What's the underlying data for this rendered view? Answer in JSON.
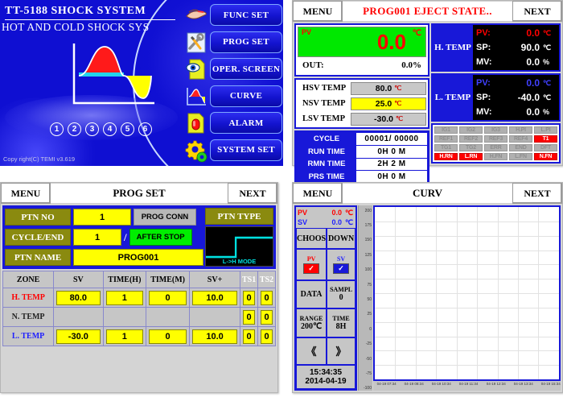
{
  "home": {
    "title_line1": "TT-5188   SHOCK SYSTEM",
    "title_line2": "HOT AND COLD SHOCK SYS",
    "copyright": "Copy right(C) TEMI v3.619",
    "step_numbers": [
      "1",
      "2",
      "3",
      "4",
      "5",
      "6"
    ],
    "menu": [
      {
        "label": "FUNC SET",
        "icon": "hand-pointer-icon"
      },
      {
        "label": "PROG SET",
        "icon": "wrench-screwdriver-icon"
      },
      {
        "label": "OPER. SCREEN",
        "icon": "eye-document-icon"
      },
      {
        "label": "CURVE",
        "icon": "curve-chart-icon"
      },
      {
        "label": "ALARM",
        "icon": "alarm-lamp-icon"
      },
      {
        "label": "SYSTEM SET",
        "icon": "gears-icon"
      }
    ]
  },
  "oper": {
    "menu_label": "MENU",
    "next_label": "NEXT",
    "title": "PROG001 EJECT STATE..",
    "pv_label": "PV",
    "pv_value": "0.0",
    "pv_unit": "℃",
    "out_label": "OUT:",
    "out_value": "0.0%",
    "sv_rows": [
      {
        "name": "HSV  TEMP",
        "value": "80.0",
        "unit": "℃",
        "style": "gray"
      },
      {
        "name": "NSV  TEMP",
        "value": "25.0",
        "unit": "℃",
        "style": "yellow"
      },
      {
        "name": "LSV  TEMP",
        "value": "-30.0",
        "unit": "℃",
        "style": "gray"
      }
    ],
    "cycle_rows": [
      {
        "name": "CYCLE",
        "value": "00001/ 00000"
      },
      {
        "name": "RUN TIME",
        "value": "0H  0 M"
      },
      {
        "name": "RMN TIME",
        "value": "2H  2 M"
      },
      {
        "name": "PRS TIME",
        "value": "0H  0 M"
      }
    ],
    "temp_blocks": [
      {
        "tag": "H. TEMP",
        "rows": [
          {
            "key": "PV:",
            "value": "0.0",
            "unit": "℃",
            "color": "#ff0000"
          },
          {
            "key": "SP:",
            "value": "90.0",
            "unit": "℃",
            "color": "#ffffff"
          },
          {
            "key": "MV:",
            "value": "0.0",
            "unit": "%",
            "color": "#ffffff"
          }
        ]
      },
      {
        "tag": "L. TEMP",
        "rows": [
          {
            "key": "PV:",
            "value": "0.0",
            "unit": "℃",
            "color": "#4040ff"
          },
          {
            "key": "SP:",
            "value": "-40.0",
            "unit": "℃",
            "color": "#ffffff"
          },
          {
            "key": "MV:",
            "value": "0.0",
            "unit": "%",
            "color": "#ffffff"
          }
        ]
      }
    ],
    "leds": [
      {
        "label": "IG1",
        "on": false
      },
      {
        "label": "IG2",
        "on": false
      },
      {
        "label": "IG3",
        "on": false
      },
      {
        "label": "H.PI",
        "on": false
      },
      {
        "label": "L.PI",
        "on": false
      },
      {
        "label": "REF1",
        "on": false
      },
      {
        "label": "REF2",
        "on": false
      },
      {
        "label": "REF3",
        "on": false
      },
      {
        "label": "REF4",
        "on": false
      },
      {
        "label": "T1",
        "on": true
      },
      {
        "label": "TG1",
        "on": false
      },
      {
        "label": "TG2",
        "on": false
      },
      {
        "label": "ERR",
        "on": false
      },
      {
        "label": "END",
        "on": false
      },
      {
        "label": "DFT",
        "on": false
      },
      {
        "label": "H.RN",
        "on": true
      },
      {
        "label": "L.RN",
        "on": true
      },
      {
        "label": "H.FN",
        "on": false
      },
      {
        "label": "L.FN",
        "on": false
      },
      {
        "label": "N.FN",
        "on": true
      }
    ]
  },
  "progset": {
    "menu_label": "MENU",
    "next_label": "NEXT",
    "title": "PROG SET",
    "ptn_no_label": "PTN NO",
    "ptn_no_value": "1",
    "cycle_end_label": "CYCLE/END",
    "cycle_value": "1",
    "end_value": "AFTER STOP",
    "prog_conn_label": "PROG CONN",
    "ptn_name_label": "PTN NAME",
    "ptn_name_value": "PROG001",
    "ptn_type_label": "PTN TYPE",
    "ptn_type_mode": "L->H MODE",
    "columns": [
      "ZONE",
      "SV",
      "TIME(H)",
      "TIME(M)",
      "SV+",
      "TS1",
      "TS2"
    ],
    "rows": [
      {
        "zone": "H. TEMP",
        "zone_color": "h",
        "sv": "80.0",
        "th": "1",
        "tm": "0",
        "svp": "10.0",
        "ts1": "0",
        "ts2": "0",
        "editable": true
      },
      {
        "zone": "N. TEMP",
        "zone_color": "n",
        "sv": "",
        "th": "",
        "tm": "",
        "svp": "",
        "ts1": "0",
        "ts2": "0",
        "editable": false
      },
      {
        "zone": "L. TEMP",
        "zone_color": "l",
        "sv": "-30.0",
        "th": "1",
        "tm": "0",
        "svp": "10.0",
        "ts1": "0",
        "ts2": "0",
        "editable": true
      }
    ]
  },
  "curv": {
    "menu_label": "MENU",
    "next_label": "NEXT",
    "title": "CURV",
    "pv_label": "PV",
    "pv_value": "0.0",
    "pv_unit": "℃",
    "sv_label": "SV",
    "sv_value": "0.0",
    "sv_unit": "℃",
    "choos_label": "CHOOS",
    "down_label": "DOWN",
    "pv_check_label": "PV",
    "sv_check_label": "SV",
    "data_label": "DATA",
    "sampl_label": "SAMPL",
    "sampl_value": "0",
    "range_label": "RANGE",
    "range_value": "200℃",
    "time_label": "TIME",
    "time_value": "8H",
    "prev_label": "《",
    "next_nav_label": "》",
    "clock_time": "15:34:35",
    "clock_date": "2014-04-19"
  },
  "chart_data": {
    "type": "line",
    "title": "CURV",
    "xlabel": "",
    "ylabel": "",
    "ylim": [
      -100,
      200
    ],
    "yticks": [
      200,
      175,
      150,
      125,
      100,
      75,
      50,
      25,
      0,
      -25,
      -50,
      -75,
      -100
    ],
    "ytick_labels": [
      "200",
      "175",
      "150",
      "125",
      "100",
      "75",
      "50",
      "25",
      "0",
      "-25",
      "-50",
      "-75",
      "-100"
    ],
    "xtick_labels": [
      "04-19 07:34",
      "04-19 08:34",
      "04-19 10:34",
      "04-19 11:34",
      "04-19 12:34",
      "04-19 13:34",
      "04-19 15:34"
    ],
    "grid": true,
    "legend": [
      "PV",
      "SV"
    ],
    "legend_colors": [
      "#ff0000",
      "#1818d8"
    ],
    "series": [
      {
        "name": "PV",
        "values": []
      },
      {
        "name": "SV",
        "values": []
      }
    ],
    "note": "empty trend plot - no sampled data (SAMPL 0)"
  }
}
